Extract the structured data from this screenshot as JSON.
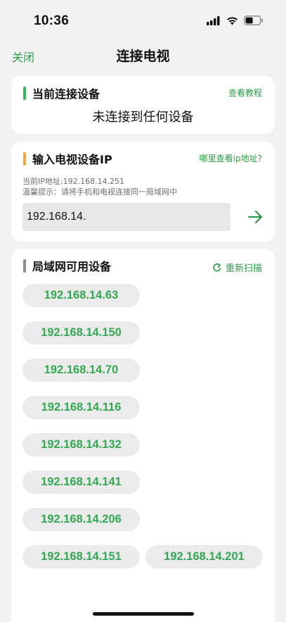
{
  "status": {
    "time": "10:36"
  },
  "nav": {
    "close_label": "关闭",
    "title": "连接电视"
  },
  "current_device": {
    "title": "当前连接设备",
    "tutorial_link": "查看教程",
    "status_text": "未连接到任何设备",
    "accent_color": "#35b85a"
  },
  "ip_input": {
    "title": "输入电视设备IP",
    "help_link": "哪里查看ip地址?",
    "current_ip": "当前IP地址:192.168.14.251",
    "tip": "温馨提示：请将手机和电视连接同一局域网中",
    "value": "192.168.14.",
    "accent_color": "#f2a93b"
  },
  "lan_devices": {
    "title": "局域网可用设备",
    "rescan_label": "重新扫描",
    "accent_color": "#8c8c8c",
    "rows": [
      [
        "192.168.14.63"
      ],
      [
        "192.168.14.150"
      ],
      [
        "192.168.14.70"
      ],
      [
        "192.168.14.116"
      ],
      [
        "192.168.14.132"
      ],
      [
        "192.168.14.141"
      ],
      [
        "192.168.14.206"
      ],
      [
        "192.168.14.151",
        "192.168.14.201"
      ]
    ]
  },
  "colors": {
    "brand_green": "#2e9b48",
    "chip_text": "#34a853",
    "background": "#f2f2f4"
  }
}
